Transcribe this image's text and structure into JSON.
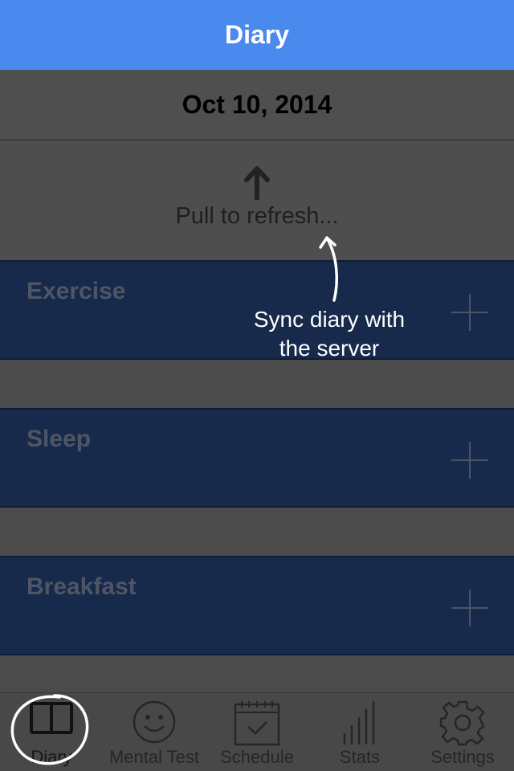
{
  "header": {
    "title": "Diary"
  },
  "date": "Oct 10, 2014",
  "refresh": {
    "label": "Pull to refresh..."
  },
  "annotation": {
    "line1": "Sync diary with",
    "line2": "the server"
  },
  "cards": [
    {
      "title": "Exercise"
    },
    {
      "title": "Sleep"
    },
    {
      "title": "Breakfast"
    }
  ],
  "tabs": [
    {
      "label": "Diary",
      "icon": "book-icon"
    },
    {
      "label": "Mental Test",
      "icon": "smiley-icon"
    },
    {
      "label": "Schedule",
      "icon": "calendar-icon"
    },
    {
      "label": "Stats",
      "icon": "bar-chart-icon"
    },
    {
      "label": "Settings",
      "icon": "gear-icon"
    }
  ],
  "colors": {
    "accent": "#4a89ee",
    "card": "#172a4c",
    "background": "#4a4a4a"
  }
}
